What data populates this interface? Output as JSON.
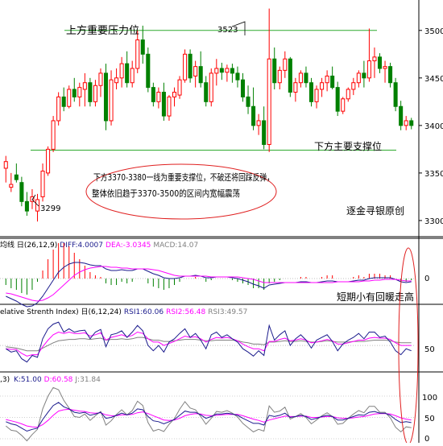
{
  "main_panel": {
    "ytick_labels": [
      "3500",
      "3450",
      "3400",
      "3350",
      "3300"
    ],
    "yticks": [
      3500,
      3450,
      3400,
      3350,
      3300
    ],
    "ylim": [
      3283,
      3532
    ],
    "resistance_label": "上方重要压力位",
    "resistance_value": 3500,
    "support_label": "下方主要支撑位",
    "support_value": 3374,
    "high_label": "3523",
    "low_label": "3299",
    "annotation_lines": [
      "下方3370-3380一线为重要支撑位，不破还将回踩反弹，",
      "整体依旧趋于3370-3500的区间内宽幅震荡"
    ],
    "watermark": "逐金寻银原创",
    "colors": {
      "up": "#ff0000",
      "down": "#008000",
      "line": "#2eaa2e",
      "ellipse": "#e02020"
    }
  },
  "macd_panel": {
    "header": {
      "prefix": "均线 ",
      "period": "日(26,12,9)",
      "diff": "DIFF:4.0007",
      "dea": "DEA:-3.0345",
      "macd": "MACD:14.07"
    },
    "ytick_labels": [
      "0"
    ],
    "note": "短期小有回暖走高",
    "colors": {
      "diff": "#1a1a8c",
      "dea": "#ff00ff",
      "hist_pos": "#ff0000",
      "hist_neg": "#008000"
    }
  },
  "rsi_panel": {
    "header": {
      "prefix": "elative Strenth Index) ",
      "period": "日(6,12,24)",
      "rsi1": "RSI1:60.06",
      "rsi2": "RSI2:56.48",
      "rsi3": "RSI3:49.57"
    },
    "ytick_labels": [
      "50"
    ],
    "colors": {
      "rsi1": "#1a1a8c",
      "rsi2": "#ff00ff",
      "rsi3": "#808080"
    }
  },
  "kdj_panel": {
    "header": {
      "prefix": ",3) ",
      "k": "K:51.00",
      "d": "D:60.58",
      "j": "J:31.84"
    },
    "ytick_labels": [
      "100",
      "50",
      "0"
    ],
    "colors": {
      "k": "#1a1a8c",
      "d": "#ff00ff",
      "j": "#808080"
    }
  },
  "chart_data": {
    "type": "candlestick",
    "ylim": [
      3283,
      3532
    ],
    "ohlc": [
      [
        3355,
        3368,
        3340,
        3362
      ],
      [
        3335,
        3350,
        3330,
        3338
      ],
      [
        3348,
        3360,
        3340,
        3343
      ],
      [
        3340,
        3346,
        3315,
        3320
      ],
      [
        3320,
        3330,
        3305,
        3310
      ],
      [
        3320,
        3333,
        3312,
        3325
      ],
      [
        3310,
        3328,
        3299,
        3322
      ],
      [
        3325,
        3360,
        3320,
        3352
      ],
      [
        3350,
        3378,
        3347,
        3375
      ],
      [
        3375,
        3410,
        3372,
        3405
      ],
      [
        3405,
        3435,
        3400,
        3430
      ],
      [
        3430,
        3440,
        3415,
        3420
      ],
      [
        3420,
        3442,
        3418,
        3438
      ],
      [
        3438,
        3450,
        3425,
        3430
      ],
      [
        3430,
        3445,
        3420,
        3440
      ],
      [
        3438,
        3455,
        3420,
        3445
      ],
      [
        3445,
        3450,
        3420,
        3425
      ],
      [
        3425,
        3448,
        3420,
        3442
      ],
      [
        3442,
        3460,
        3430,
        3455
      ],
      [
        3455,
        3465,
        3395,
        3405
      ],
      [
        3405,
        3458,
        3400,
        3448
      ],
      [
        3445,
        3460,
        3438,
        3450
      ],
      [
        3450,
        3472,
        3440,
        3465
      ],
      [
        3465,
        3478,
        3440,
        3445
      ],
      [
        3445,
        3468,
        3440,
        3460
      ],
      [
        3460,
        3500,
        3455,
        3490
      ],
      [
        3490,
        3505,
        3465,
        3475
      ],
      [
        3475,
        3482,
        3435,
        3440
      ],
      [
        3440,
        3445,
        3420,
        3425
      ],
      [
        3425,
        3440,
        3418,
        3435
      ],
      [
        3435,
        3445,
        3405,
        3410
      ],
      [
        3410,
        3432,
        3405,
        3430
      ],
      [
        3430,
        3440,
        3420,
        3435
      ],
      [
        3432,
        3452,
        3428,
        3448
      ],
      [
        3448,
        3480,
        3445,
        3475
      ],
      [
        3475,
        3480,
        3445,
        3450
      ],
      [
        3452,
        3468,
        3440,
        3462
      ],
      [
        3462,
        3478,
        3440,
        3445
      ],
      [
        3445,
        3452,
        3420,
        3425
      ],
      [
        3425,
        3460,
        3420,
        3455
      ],
      [
        3455,
        3470,
        3442,
        3460
      ],
      [
        3460,
        3466,
        3448,
        3456
      ],
      [
        3456,
        3464,
        3446,
        3460
      ],
      [
        3460,
        3465,
        3445,
        3455
      ],
      [
        3455,
        3462,
        3440,
        3448
      ],
      [
        3448,
        3455,
        3425,
        3430
      ],
      [
        3430,
        3442,
        3412,
        3420
      ],
      [
        3420,
        3440,
        3395,
        3400
      ],
      [
        3400,
        3412,
        3390,
        3405
      ],
      [
        3405,
        3420,
        3375,
        3380
      ],
      [
        3380,
        3523,
        3372,
        3470
      ],
      [
        3470,
        3482,
        3438,
        3445
      ],
      [
        3445,
        3462,
        3438,
        3458
      ],
      [
        3458,
        3478,
        3450,
        3470
      ],
      [
        3470,
        3472,
        3430,
        3435
      ],
      [
        3435,
        3450,
        3425,
        3445
      ],
      [
        3445,
        3458,
        3440,
        3455
      ],
      [
        3455,
        3462,
        3440,
        3445
      ],
      [
        3445,
        3450,
        3420,
        3425
      ],
      [
        3425,
        3442,
        3418,
        3438
      ],
      [
        3438,
        3450,
        3430,
        3445
      ],
      [
        3445,
        3458,
        3436,
        3452
      ],
      [
        3452,
        3462,
        3438,
        3440
      ],
      [
        3440,
        3446,
        3410,
        3415
      ],
      [
        3415,
        3430,
        3412,
        3428
      ],
      [
        3428,
        3440,
        3425,
        3438
      ],
      [
        3438,
        3450,
        3432,
        3445
      ],
      [
        3445,
        3458,
        3440,
        3455
      ],
      [
        3455,
        3468,
        3440,
        3450
      ],
      [
        3450,
        3502,
        3446,
        3468
      ],
      [
        3468,
        3482,
        3450,
        3472
      ],
      [
        3472,
        3476,
        3455,
        3460
      ],
      [
        3460,
        3468,
        3445,
        3462
      ],
      [
        3462,
        3466,
        3440,
        3445
      ],
      [
        3445,
        3450,
        3415,
        3420
      ],
      [
        3420,
        3426,
        3395,
        3400
      ],
      [
        3400,
        3410,
        3395,
        3405
      ],
      [
        3405,
        3408,
        3396,
        3400
      ]
    ],
    "resistance": 3500,
    "support": 3374,
    "macd": {
      "diff": [
        -22,
        -25,
        -28,
        -32,
        -35,
        -34,
        -30,
        -22,
        -12,
        -2,
        8,
        14,
        18,
        20,
        20,
        19,
        17,
        16,
        16,
        12,
        10,
        10,
        11,
        10,
        10,
        12,
        12,
        9,
        6,
        4,
        1,
        0,
        0,
        1,
        3,
        3,
        4,
        3,
        1,
        1,
        2,
        2,
        2,
        1,
        0,
        -2,
        -4,
        -7,
        -9,
        -12,
        -8,
        -7,
        -6,
        -5,
        -5,
        -5,
        -4,
        -4,
        -5,
        -5,
        -4,
        -3,
        -3,
        -4,
        -4,
        -4,
        -3,
        -2,
        -2,
        0,
        1,
        1,
        1,
        1,
        -1,
        -4,
        -5,
        -4
      ],
      "dea": [
        -18,
        -19,
        -21,
        -23,
        -25,
        -27,
        -28,
        -27,
        -24,
        -20,
        -14,
        -8,
        -2,
        4,
        8,
        11,
        13,
        14,
        15,
        15,
        14,
        14,
        13,
        13,
        12,
        12,
        12,
        12,
        11,
        10,
        8,
        6,
        4,
        3,
        3,
        3,
        3,
        3,
        3,
        2,
        2,
        2,
        2,
        2,
        2,
        1,
        0,
        -1,
        -3,
        -5,
        -5,
        -5,
        -5,
        -5,
        -5,
        -5,
        -5,
        -5,
        -5,
        -5,
        -5,
        -5,
        -5,
        -4,
        -4,
        -4,
        -4,
        -4,
        -3,
        -3,
        -2,
        -2,
        -1,
        -1,
        -1,
        -2,
        -3,
        -3
      ],
      "hist": [
        -8,
        -12,
        -14,
        -18,
        -20,
        -14,
        -4,
        10,
        24,
        36,
        44,
        44,
        40,
        32,
        24,
        16,
        8,
        4,
        2,
        -6,
        -8,
        -8,
        -4,
        -6,
        -4,
        0,
        0,
        -6,
        -10,
        -12,
        -14,
        -12,
        -8,
        -4,
        0,
        0,
        2,
        0,
        -4,
        -2,
        0,
        0,
        0,
        -2,
        -4,
        -6,
        -8,
        -12,
        -12,
        -14,
        -6,
        -4,
        -2,
        0,
        0,
        0,
        2,
        2,
        0,
        0,
        2,
        4,
        4,
        0,
        0,
        0,
        2,
        4,
        2,
        6,
        6,
        6,
        4,
        4,
        0,
        -4,
        -4,
        -2
      ]
    },
    "rsi": {
      "rsi1": [
        45,
        40,
        42,
        30,
        25,
        35,
        32,
        60,
        75,
        82,
        85,
        70,
        75,
        70,
        72,
        73,
        60,
        70,
        74,
        48,
        66,
        68,
        72,
        62,
        70,
        80,
        72,
        50,
        42,
        50,
        40,
        55,
        60,
        68,
        75,
        62,
        68,
        58,
        45,
        66,
        70,
        62,
        66,
        60,
        55,
        45,
        40,
        34,
        42,
        35,
        80,
        58,
        66,
        72,
        50,
        60,
        66,
        58,
        46,
        58,
        62,
        66,
        56,
        42,
        52,
        58,
        62,
        68,
        60,
        70,
        70,
        62,
        64,
        55,
        42,
        36,
        45,
        42
      ],
      "rsi2": [
        45,
        44,
        44,
        38,
        34,
        36,
        36,
        48,
        58,
        66,
        70,
        68,
        70,
        68,
        68,
        69,
        64,
        66,
        69,
        58,
        62,
        64,
        66,
        63,
        65,
        70,
        68,
        60,
        55,
        55,
        50,
        53,
        56,
        60,
        64,
        62,
        63,
        60,
        55,
        59,
        62,
        61,
        62,
        60,
        57,
        52,
        48,
        45,
        45,
        42,
        56,
        56,
        59,
        61,
        57,
        58,
        60,
        58,
        54,
        55,
        57,
        59,
        57,
        52,
        52,
        54,
        56,
        58,
        58,
        61,
        62,
        61,
        61,
        59,
        54,
        50,
        50,
        50
      ],
      "rsi3": [
        48,
        47,
        46,
        44,
        42,
        42,
        42,
        46,
        50,
        54,
        57,
        58,
        59,
        59,
        60,
        60,
        59,
        60,
        61,
        58,
        59,
        59,
        60,
        59,
        60,
        62,
        62,
        60,
        58,
        58,
        56,
        56,
        57,
        58,
        59,
        59,
        59,
        58,
        57,
        57,
        58,
        58,
        58,
        58,
        57,
        55,
        54,
        52,
        52,
        51,
        55,
        55,
        56,
        57,
        56,
        56,
        57,
        56,
        55,
        55,
        56,
        57,
        56,
        55,
        55,
        55,
        56,
        56,
        56,
        57,
        58,
        58,
        58,
        57,
        55,
        54,
        54,
        54
      ]
    },
    "kdj": {
      "k": [
        40,
        35,
        32,
        25,
        18,
        22,
        25,
        45,
        62,
        78,
        85,
        75,
        70,
        62,
        60,
        62,
        55,
        58,
        62,
        48,
        50,
        55,
        60,
        56,
        60,
        70,
        68,
        52,
        42,
        40,
        35,
        40,
        45,
        55,
        65,
        62,
        62,
        56,
        48,
        52,
        58,
        58,
        60,
        58,
        55,
        48,
        42,
        36,
        36,
        32,
        55,
        52,
        55,
        60,
        50,
        52,
        55,
        52,
        45,
        48,
        52,
        55,
        52,
        44,
        44,
        48,
        52,
        56,
        55,
        62,
        64,
        60,
        60,
        55,
        45,
        38,
        40,
        38
      ],
      "d": [
        45,
        42,
        39,
        35,
        30,
        28,
        27,
        33,
        43,
        55,
        65,
        68,
        69,
        67,
        65,
        64,
        61,
        60,
        61,
        56,
        54,
        54,
        56,
        56,
        57,
        61,
        63,
        59,
        54,
        49,
        44,
        43,
        44,
        48,
        54,
        57,
        59,
        58,
        55,
        54,
        55,
        56,
        57,
        57,
        57,
        54,
        50,
        46,
        43,
        39,
        44,
        47,
        50,
        53,
        52,
        52,
        53,
        53,
        50,
        50,
        51,
        52,
        52,
        49,
        48,
        48,
        49,
        51,
        52,
        55,
        58,
        59,
        59,
        58,
        54,
        49,
        46,
        44
      ],
      "j": [
        30,
        20,
        18,
        8,
        -5,
        10,
        22,
        70,
        100,
        120,
        115,
        90,
        72,
        52,
        50,
        58,
        43,
        54,
        64,
        32,
        42,
        57,
        68,
        56,
        66,
        88,
        78,
        38,
        18,
        22,
        17,
        34,
        47,
        69,
        87,
        72,
        68,
        52,
        34,
        48,
        64,
        62,
        66,
        60,
        51,
        36,
        26,
        16,
        22,
        18,
        77,
        62,
        65,
        74,
        46,
        52,
        59,
        50,
        35,
        44,
        54,
        61,
        52,
        34,
        36,
        48,
        58,
        66,
        61,
        76,
        76,
        62,
        62,
        49,
        27,
        16,
        28,
        26
      ]
    },
    "xlabel": "",
    "ylabel": ""
  }
}
